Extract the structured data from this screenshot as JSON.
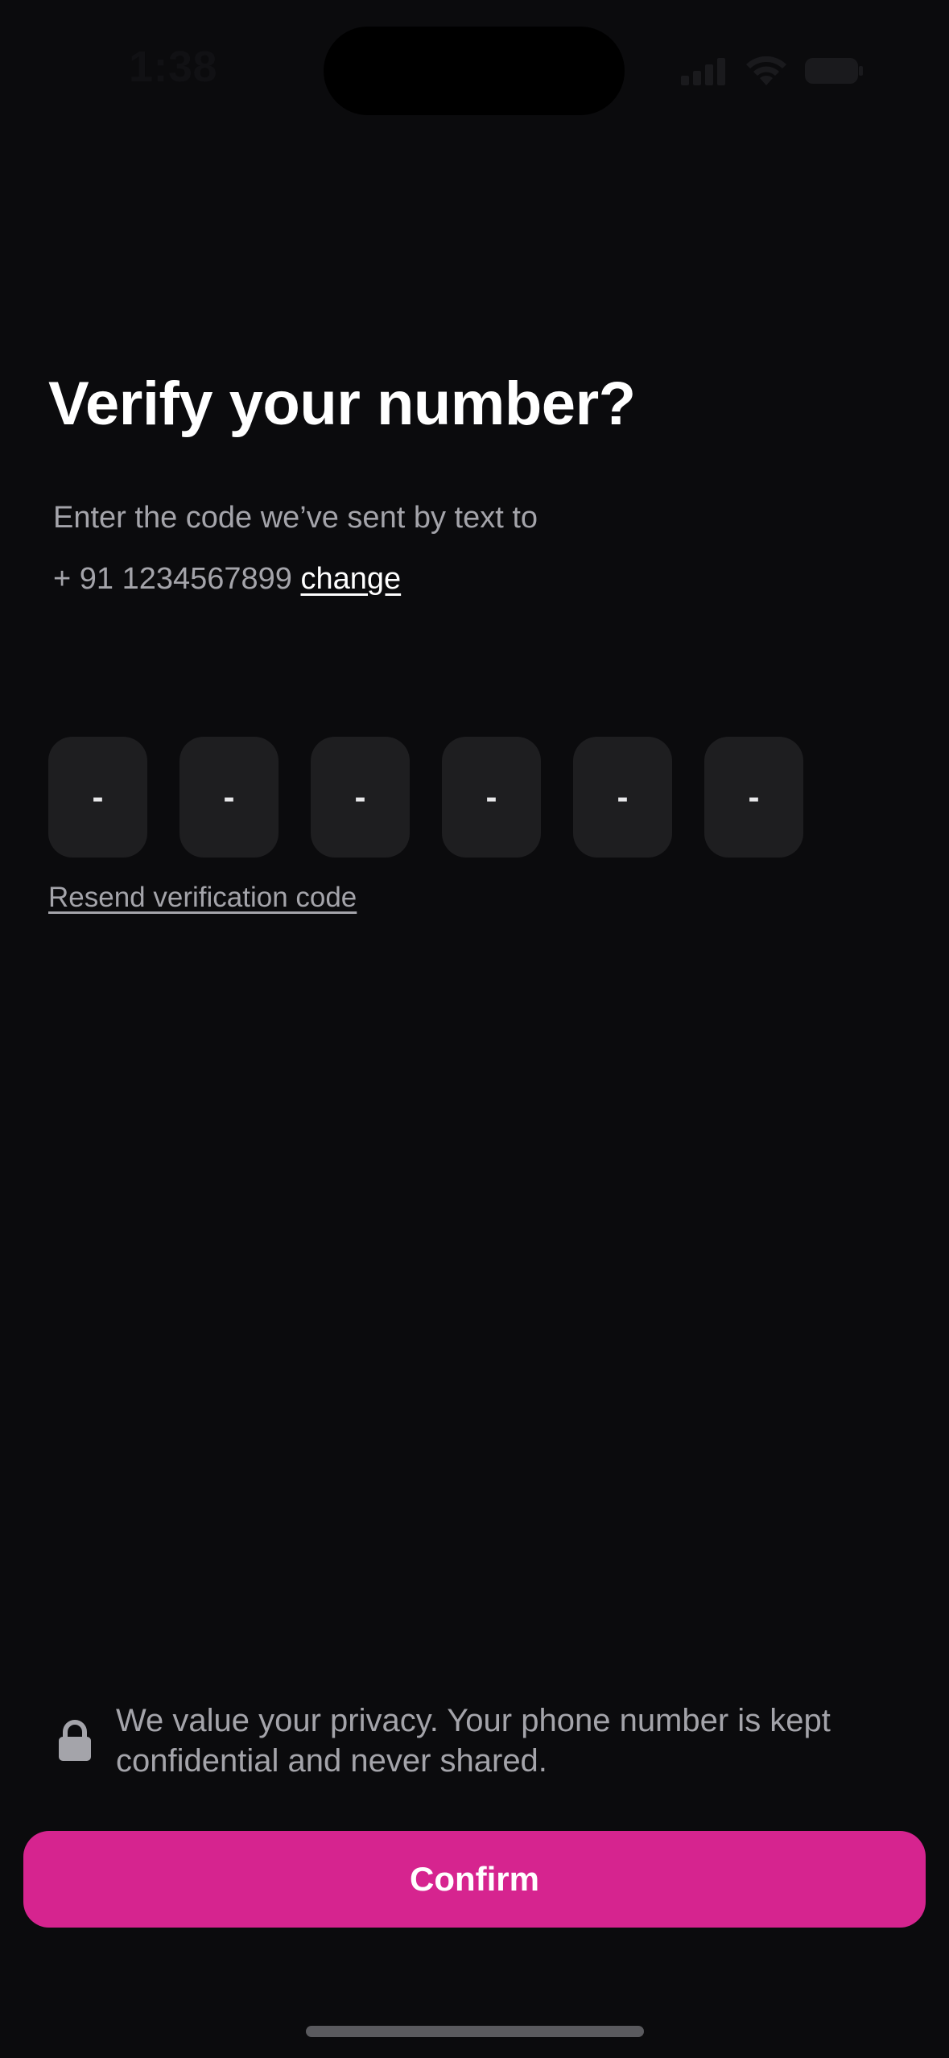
{
  "status_bar": {
    "time": "1:38",
    "icons": [
      "signal-icon",
      "wifi-icon",
      "battery-icon"
    ]
  },
  "header": {
    "title": "Verify your number?",
    "subtitle": "Enter the code we’ve sent by text to",
    "phone_number": "+ 91 1234567899",
    "change_label": "change"
  },
  "otp": {
    "digits": [
      "-",
      "-",
      "-",
      "-",
      "-",
      "-"
    ]
  },
  "resend_label": "Resend verification code",
  "privacy": {
    "icon": "lock-icon",
    "text": "We value your privacy. Your phone number is kept confidential and never shared."
  },
  "confirm_label": "Confirm",
  "colors": {
    "background": "#0b0b0d",
    "accent": "#d6248f",
    "otp_box": "#1e1e20",
    "muted_text": "#a4a4aa"
  }
}
